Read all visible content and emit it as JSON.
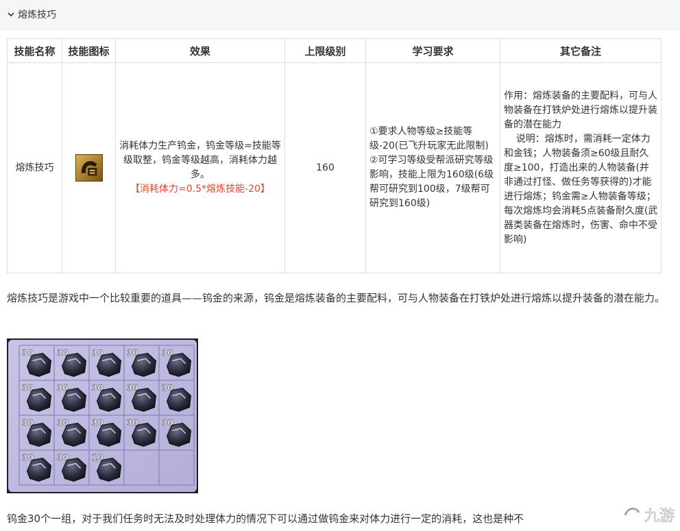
{
  "section": {
    "title": "熔炼技巧"
  },
  "table": {
    "headers": [
      "技能名称",
      "技能图标",
      "效果",
      "上限级别",
      "学习要求",
      "其它备注"
    ],
    "row": {
      "name": "熔炼技巧",
      "effect_text": "消耗体力生产钨金，钨金等级=技能等级取整，钨金等级越高，消耗体力越多。",
      "effect_formula": "【消耗体力=0.5*熔炼技能-20】",
      "max_level": "160",
      "requirement": "①要求人物等级≥技能等级-20(已飞升玩家无此限制)\n②可学习等级受帮派研究等级影响，技能上限为160级(6级帮可研究到100级，7级帮可研究到160级)",
      "notes": "作用：熔炼装备的主要配料，可与人物装备在打铁炉处进行熔炼以提升装备的潜在能力\n    说明：熔炼时，需消耗一定体力和金钱；人物装备须≥60级且耐久度≥100，打造出来的人物装备(并非通过打怪、做任务等获得的)才能进行熔炼；钨金需≥人物装备等级；每次熔炼均会消耗5点装备耐久度(武器类装备在熔炼时，伤害、命中不受影响)"
    }
  },
  "paragraph1": "熔炼技巧是游戏中一个比较重要的道具——钨金的来源，钨金是熔炼装备的主要配料，可与人物装备在打铁炉处进行熔炼以提升装备的潜在能力。",
  "inventory": {
    "counts": [
      "30",
      "30",
      "30",
      "30",
      "30",
      "30",
      "30",
      "30",
      "30",
      "30",
      "30",
      "30",
      "30",
      "30",
      "30",
      "30",
      "30",
      "10"
    ]
  },
  "paragraph2": "钨金30个一组，对于我们任务时无法及时处理体力的情况下可以通过做钨金来对体力进行一定的消耗，这也是种不",
  "watermark": {
    "text": "九游"
  },
  "colors": {
    "formula": "#e0462e",
    "header_bg": "#f5f6f8",
    "border": "#dcdcdc"
  }
}
